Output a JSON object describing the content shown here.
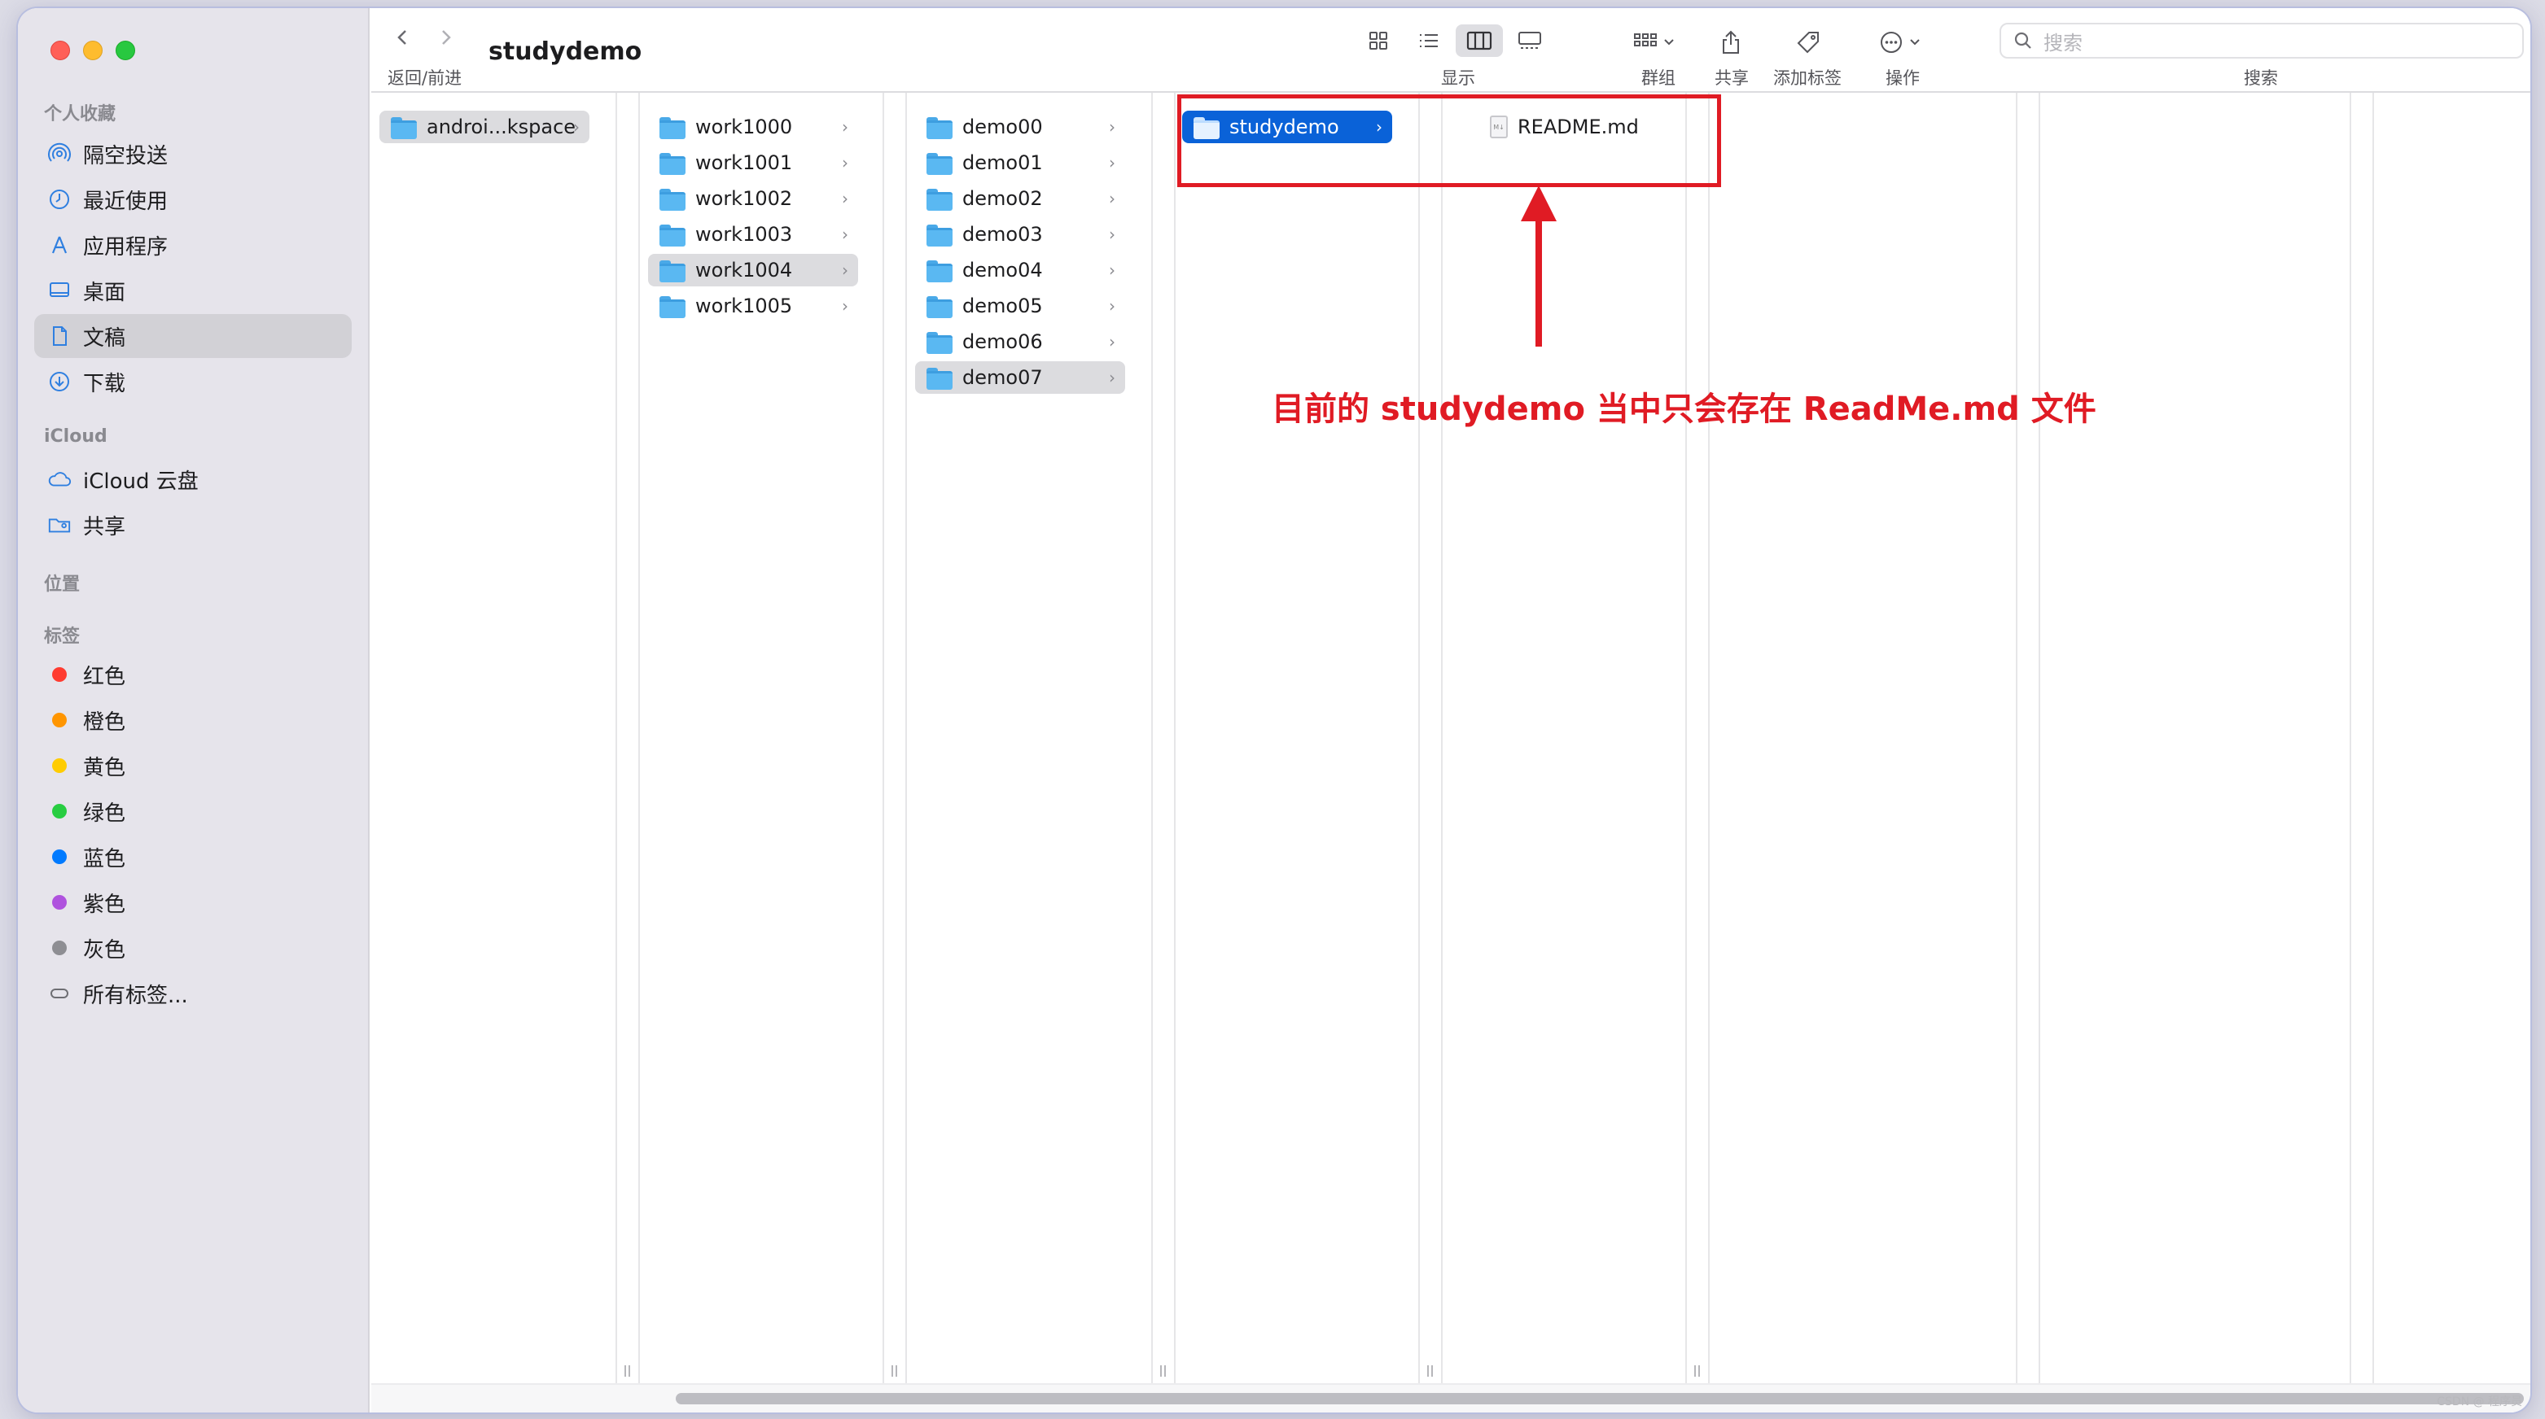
{
  "window": {
    "title": "studydemo"
  },
  "toolbar": {
    "nav_label": "返回/前进",
    "view_label": "显示",
    "group_label": "群组",
    "share_label": "共享",
    "tag_label": "添加标签",
    "action_label": "操作",
    "search_label": "搜索",
    "search_placeholder": "搜索"
  },
  "sidebar": {
    "favorites_title": "个人收藏",
    "favorites": [
      {
        "label": "隔空投送",
        "icon": "airdrop-icon"
      },
      {
        "label": "最近使用",
        "icon": "clock-icon"
      },
      {
        "label": "应用程序",
        "icon": "applications-icon"
      },
      {
        "label": "桌面",
        "icon": "desktop-icon"
      },
      {
        "label": "文稿",
        "icon": "document-icon",
        "selected": true
      },
      {
        "label": "下载",
        "icon": "download-icon"
      }
    ],
    "icloud_title": "iCloud",
    "icloud": [
      {
        "label": "iCloud 云盘",
        "icon": "cloud-icon"
      },
      {
        "label": "共享",
        "icon": "shared-folder-icon"
      }
    ],
    "locations_title": "位置",
    "tags_title": "标签",
    "tags": [
      {
        "label": "红色",
        "color": "#ff3b30"
      },
      {
        "label": "橙色",
        "color": "#ff9500"
      },
      {
        "label": "黄色",
        "color": "#ffcc00"
      },
      {
        "label": "绿色",
        "color": "#28cd41"
      },
      {
        "label": "蓝色",
        "color": "#007aff"
      },
      {
        "label": "紫色",
        "color": "#af52de"
      },
      {
        "label": "灰色",
        "color": "#8e8e93"
      }
    ],
    "all_tags": "所有标签..."
  },
  "columns": {
    "col1": [
      {
        "name": "androi...kspace",
        "selected": "gray"
      }
    ],
    "col2": [
      {
        "name": "work1000"
      },
      {
        "name": "work1001"
      },
      {
        "name": "work1002"
      },
      {
        "name": "work1003"
      },
      {
        "name": "work1004",
        "selected": "gray"
      },
      {
        "name": "work1005"
      }
    ],
    "col3": [
      {
        "name": "demo00"
      },
      {
        "name": "demo01"
      },
      {
        "name": "demo02"
      },
      {
        "name": "demo03"
      },
      {
        "name": "demo04"
      },
      {
        "name": "demo05"
      },
      {
        "name": "demo06"
      },
      {
        "name": "demo07",
        "selected": "gray"
      }
    ],
    "col4": [
      {
        "name": "studydemo",
        "selected": "blue"
      }
    ],
    "col5": [
      {
        "name": "README.md",
        "file_badge": "M↓"
      }
    ]
  },
  "annotation": {
    "text": "目前的 studydemo 当中只会存在 ReadMe.md 文件"
  },
  "watermark": "CSDN @ 程序员"
}
